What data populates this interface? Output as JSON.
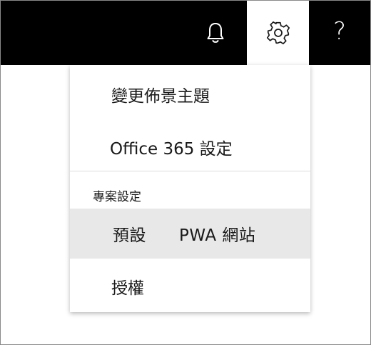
{
  "topbar": {
    "bell_icon": "bell-icon",
    "gear_icon": "gear-icon",
    "help_icon": "question-mark-icon",
    "help_glyph": "?",
    "background": "#000000"
  },
  "settings_menu": {
    "items": [
      {
        "label": "變更佈景主題"
      },
      {
        "label": "Office 365 設定"
      }
    ],
    "section_header": "專案設定",
    "project_items": [
      {
        "label": "預設 PWA 網站",
        "highlighted": true
      },
      {
        "label": "授權"
      }
    ],
    "highlight_color": "#e8e8e8"
  }
}
